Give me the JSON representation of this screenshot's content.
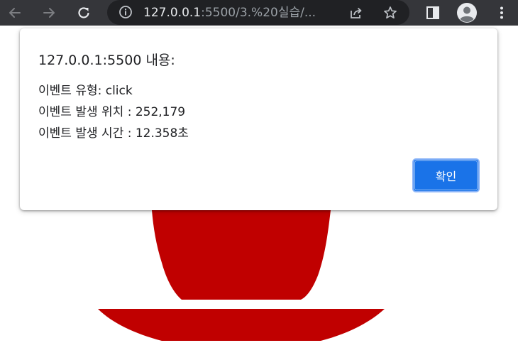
{
  "browser": {
    "url_host": "127.0.0.1",
    "url_rest": ":5500/3.%20실습/...",
    "icons": [
      "back-icon",
      "forward-icon",
      "reload-icon",
      "info-icon",
      "share-icon",
      "star-icon",
      "sidebar-icon",
      "profile-icon",
      "menu-icon"
    ]
  },
  "dialog": {
    "title": "127.0.0.1:5500 내용:",
    "lines": [
      "이벤트 유형: click",
      "이벤트 발생 위치 : 252,179",
      "이벤트 발생 시간 : 12.358초"
    ],
    "ok_label": "확인"
  },
  "colors": {
    "toolbar": "#35363a",
    "omnibox": "#202124",
    "cup_red": "#c00000",
    "button": "#1a73e8"
  }
}
